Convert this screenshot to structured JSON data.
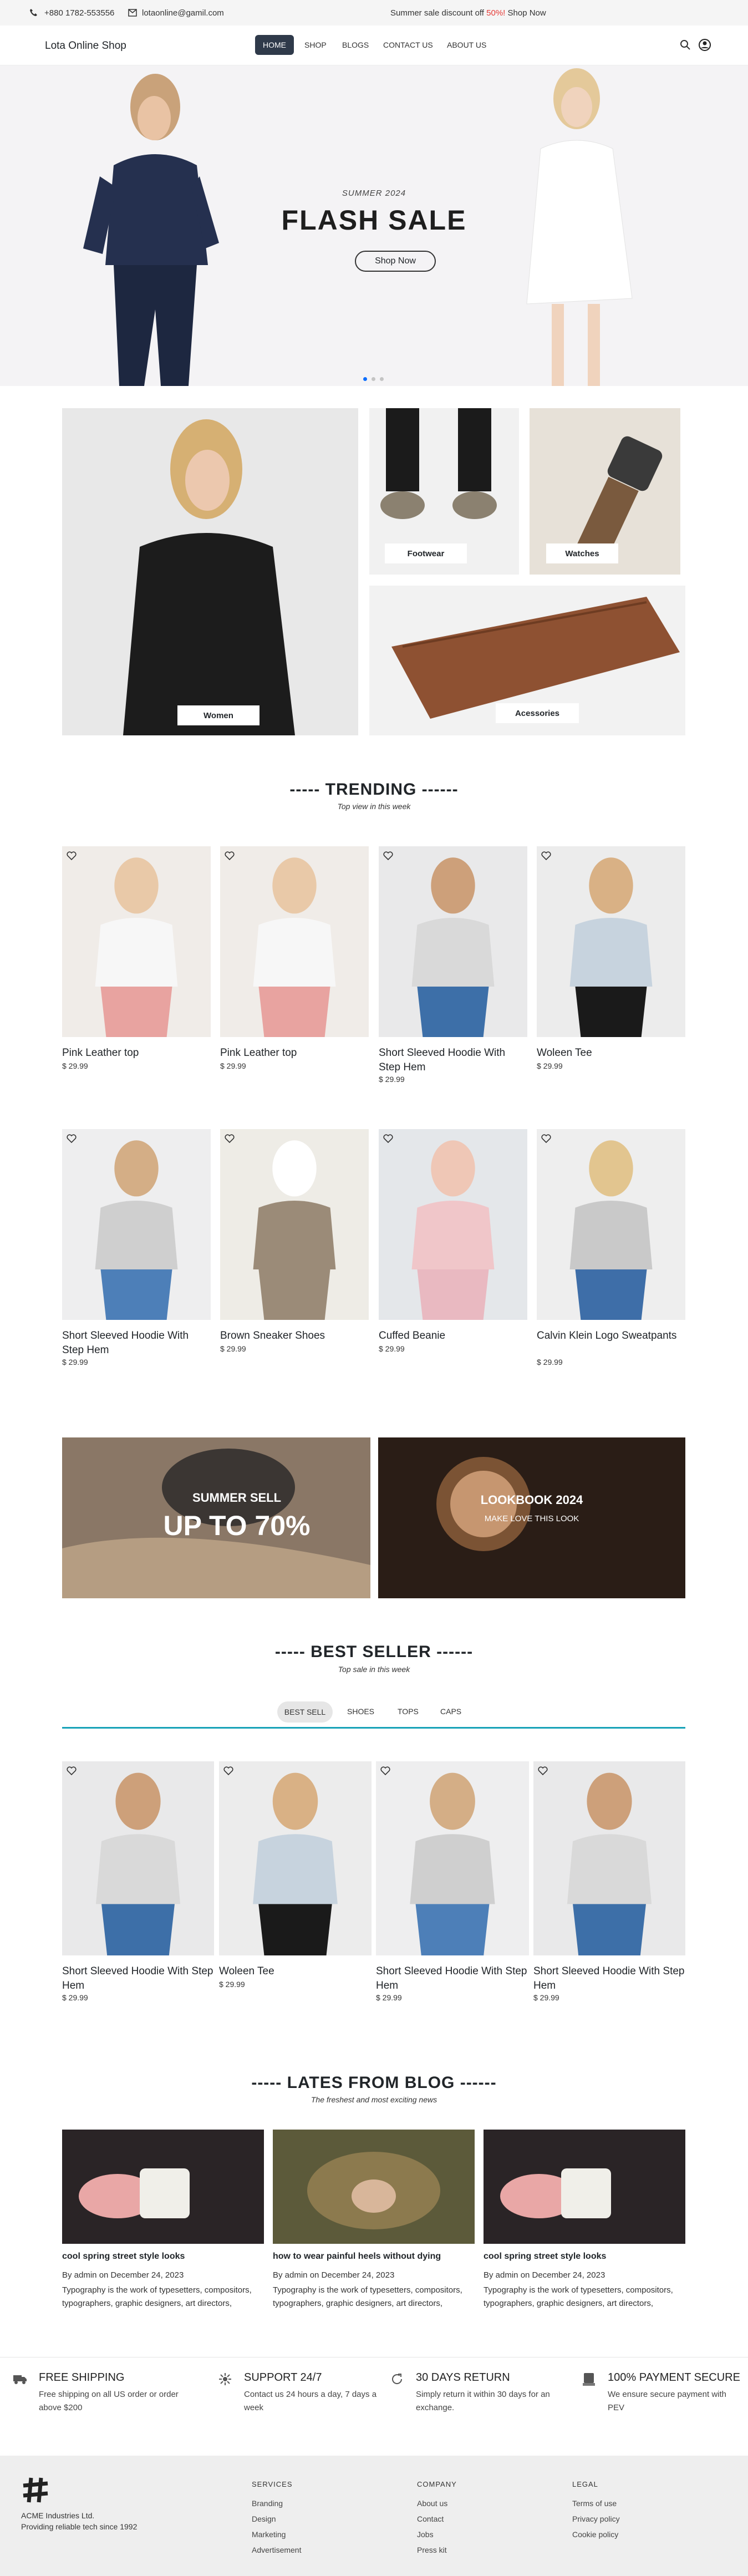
{
  "topbar": {
    "phone": "+880 1782-553556",
    "email": "lotaonline@gamil.com",
    "promo_pre": "Summer sale discount off ",
    "promo_pct": "50%!",
    "promo_link": "Shop Now"
  },
  "nav": {
    "brand": "Lota Online Shop",
    "links": [
      "HOME",
      "SHOP",
      "BLOGS",
      "CONTACT US",
      "ABOUT US"
    ]
  },
  "hero": {
    "kicker": "SUMMER 2024",
    "title": "FLASH SALE",
    "button": "Shop Now"
  },
  "categories": [
    "Women",
    "Footwear",
    "Watches",
    "Acessories"
  ],
  "trending": {
    "title": "----- TRENDING ------",
    "subtitle": "Top view in this week",
    "products": [
      {
        "name": "Pink Leather top",
        "price": "$ 29.99"
      },
      {
        "name": "Pink Leather top",
        "price": "$ 29.99"
      },
      {
        "name": "Short Sleeved Hoodie With Step Hem",
        "price": "$ 29.99"
      },
      {
        "name": "Woleen Tee",
        "price": "$ 29.99"
      },
      {
        "name": "Short Sleeved Hoodie With Step Hem",
        "price": "$ 29.99"
      },
      {
        "name": "Brown Sneaker Shoes",
        "price": "$ 29.99"
      },
      {
        "name": "Cuffed Beanie",
        "price": "$ 29.99"
      },
      {
        "name": "Calvin Klein Logo Sweatpants",
        "price": "$ 29.99"
      }
    ]
  },
  "banners": [
    {
      "title": "SUMMER SELL",
      "big": "UP TO 70%"
    },
    {
      "title": "LOOKBOOK 2024",
      "sub": "MAKE LOVE THIS LOOK"
    }
  ],
  "bestseller": {
    "title": "----- BEST SELLER ------",
    "subtitle": "Top sale in this week",
    "tabs": [
      "BEST SELL",
      "SHOES",
      "TOPS",
      "CAPS"
    ],
    "products": [
      {
        "name": "Short Sleeved Hoodie With Step Hem",
        "price": "$ 29.99"
      },
      {
        "name": "Woleen Tee",
        "price": "$ 29.99"
      },
      {
        "name": "Short Sleeved Hoodie With Step Hem",
        "price": "$ 29.99"
      },
      {
        "name": "Short Sleeved Hoodie With Step Hem",
        "price": "$ 29.99"
      }
    ]
  },
  "blog": {
    "title": "----- LATES FROM BLOG ------",
    "subtitle": "The freshest and most exciting news",
    "posts": [
      {
        "title": "cool spring street style looks",
        "meta": "By admin on December 24, 2023",
        "text": "Typography is the work of typesetters, compositors, typographers, graphic designers, art directors,"
      },
      {
        "title": "how to wear painful heels without dying",
        "meta": "By admin on December 24, 2023",
        "text": "Typography is the work of typesetters, compositors, typographers, graphic designers, art directors,"
      },
      {
        "title": "cool spring street style looks",
        "meta": "By admin on December 24, 2023",
        "text": "Typography is the work of typesetters, compositors, typographers, graphic designers, art directors,"
      }
    ]
  },
  "features": [
    {
      "icon": "truck-icon",
      "title": "FREE SHIPPING",
      "text": "Free shipping on all US order or order above $200"
    },
    {
      "icon": "support-icon",
      "title": "SUPPORT 24/7",
      "text": "Contact us 24 hours a day, 7 days a week"
    },
    {
      "icon": "return-icon",
      "title": "30 DAYS RETURN",
      "text": "Simply return it within 30 days for an exchange."
    },
    {
      "icon": "payment-icon",
      "title": "100% PAYMENT SECURE",
      "text": "We ensure secure payment with PEV"
    }
  ],
  "footer": {
    "company": "ACME Industries Ltd.",
    "tagline": "Providing reliable tech since 1992",
    "columns": [
      {
        "head": "SERVICES",
        "links": [
          "Branding",
          "Design",
          "Marketing",
          "Advertisement"
        ]
      },
      {
        "head": "COMPANY",
        "links": [
          "About us",
          "Contact",
          "Jobs",
          "Press kit"
        ]
      },
      {
        "head": "LEGAL",
        "links": [
          "Terms of use",
          "Privacy policy",
          "Cookie policy"
        ]
      }
    ]
  },
  "colors": {
    "nav_active": "#2f3a4a",
    "promo_red": "#e53935",
    "accent_line": "#17a2b8",
    "dot_active": "#0d6efd"
  }
}
